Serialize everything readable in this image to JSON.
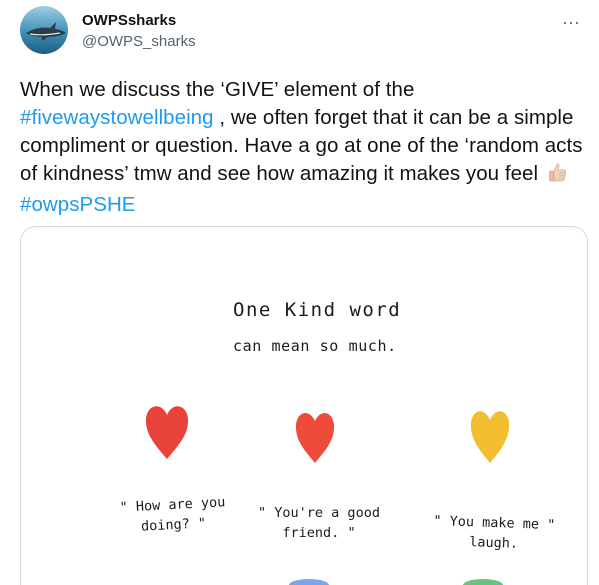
{
  "user": {
    "display_name": "OWPSsharks",
    "handle": "@OWPS_sharks",
    "avatar_icon": "shark-avatar-icon"
  },
  "more_label": "···",
  "tweet": {
    "part1": "When we discuss the ‘GIVE’ element of the ",
    "hashtag1": "#fivewaystowellbeing",
    "part2": " , we often forget that it can be a simple compliment or question. Have a go at one of the ‘random acts of kindness’ tmw and see how amazing it makes you feel ",
    "emoji": "thumbs-up-emoji-icon",
    "hashtag2": "#owpsPSHE"
  },
  "image": {
    "title_line1": "One Kind word",
    "title_line2": "can mean so much.",
    "captions": [
      {
        "line1": "\" How are you",
        "line2": "doing? \""
      },
      {
        "line1": "\" You're a good",
        "line2": "friend. \""
      },
      {
        "line1": "\" You make me \"",
        "line2": "laugh."
      }
    ],
    "heart_colors": [
      "#e8423a",
      "#ee4b3a",
      "#f2bd2e"
    ]
  },
  "colors": {
    "link": "#1d9bf0",
    "text": "#0f1419",
    "muted": "#536471",
    "border": "#cfd9de"
  }
}
